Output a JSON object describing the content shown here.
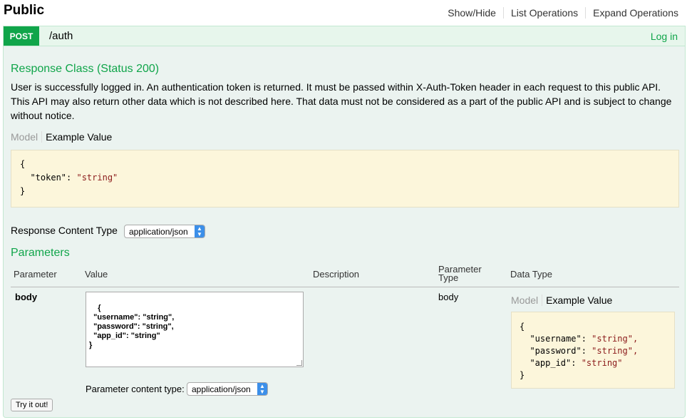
{
  "section": {
    "title": "Public",
    "links": [
      "Show/Hide",
      "List Operations",
      "Expand Operations"
    ]
  },
  "operation": {
    "method": "POST",
    "path": "/auth",
    "login_link": "Log in"
  },
  "response_class": {
    "title": "Response Class (Status 200)",
    "description": "User is successfully logged in. An authentication token is returned. It must be passed within X-Auth-Token header in each request to this public API. This API may also return other data which is not described here. That data must not be considered as a part of the public API and is subject to change without notice.",
    "tab_model": "Model",
    "tab_example": "Example Value",
    "example_lines": [
      "{",
      "  \"token\": ",
      "\"string\"",
      "}"
    ]
  },
  "response_content_type": {
    "label": "Response Content Type",
    "value": "application/json"
  },
  "parameters": {
    "title": "Parameters",
    "headers": {
      "parameter": "Parameter",
      "value": "Value",
      "description": "Description",
      "parameter_type_1": "Parameter",
      "parameter_type_2": "Type",
      "data_type": "Data Type"
    },
    "row": {
      "name": "body",
      "value": "{\n  \"username\": \"string\",\n  \"password\": \"string\",\n  \"app_id\": \"string\"\n}",
      "parameter_type": "body",
      "tab_model": "Model",
      "tab_example": "Example Value",
      "example": {
        "open": "{",
        "username_key": "  \"username\": ",
        "password_key": "  \"password\": ",
        "app_id_key": "  \"app_id\": ",
        "string_comma": "\"string\",",
        "string": "\"string\"",
        "close": "}"
      }
    },
    "content_type_label": "Parameter content type:",
    "content_type_value": "application/json"
  },
  "try_button": "Try it out!"
}
